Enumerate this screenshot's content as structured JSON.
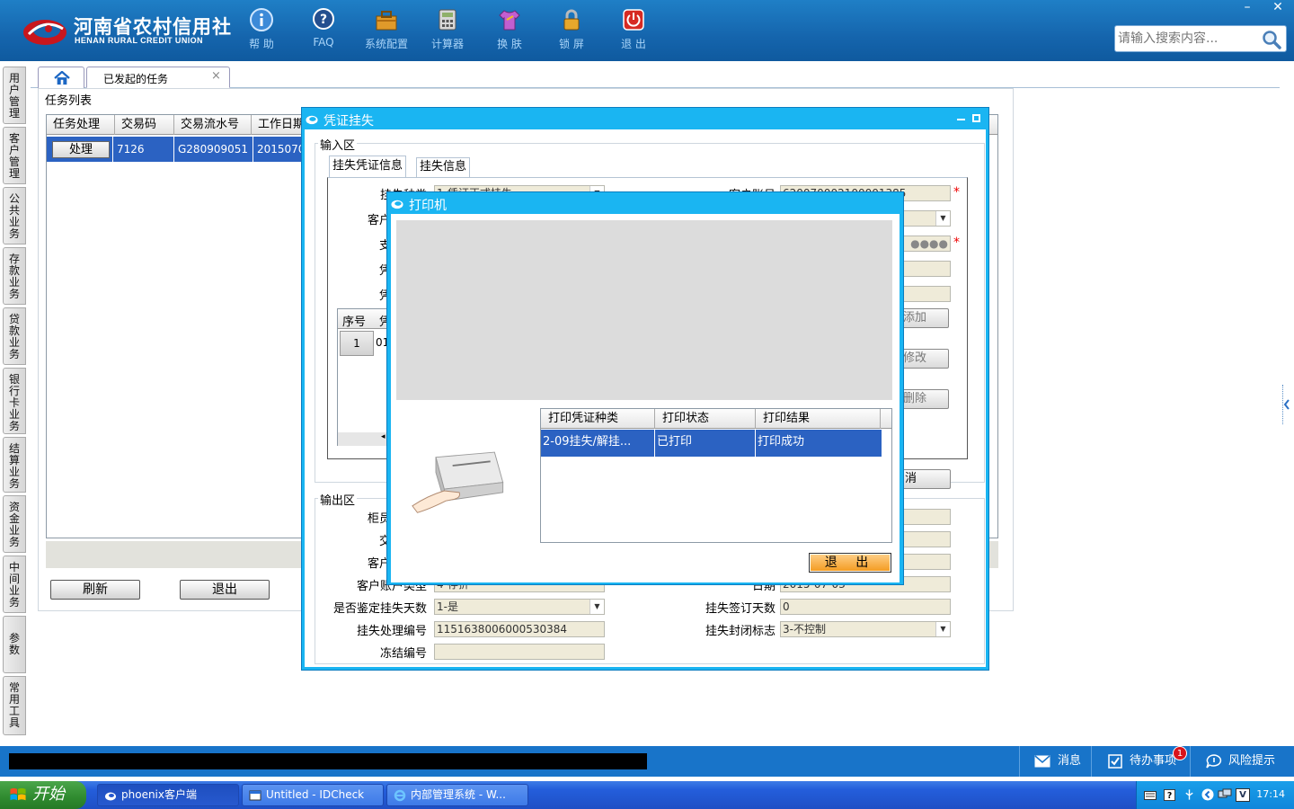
{
  "header": {
    "logo_cn": "河南省农村信用社",
    "logo_en": "HENAN RURAL CREDIT UNION",
    "toolbar": [
      {
        "label": "帮 助",
        "icon": "info-icon"
      },
      {
        "label": "FAQ",
        "icon": "help-icon"
      },
      {
        "label": "系统配置",
        "icon": "toolbox-icon"
      },
      {
        "label": "计算器",
        "icon": "calculator-icon"
      },
      {
        "label": "换 肤",
        "icon": "shirt-icon"
      },
      {
        "label": "锁 屏",
        "icon": "lock-icon"
      },
      {
        "label": "退 出",
        "icon": "power-icon"
      }
    ],
    "search_placeholder": "请输入搜索内容...",
    "window_controls": {
      "minimize": "–",
      "close": "✕"
    }
  },
  "left_nav": [
    "用户管理",
    "客户管理",
    "公共业务",
    "存款业务",
    "贷款业务",
    "银行卡业务",
    "结算业务",
    "资金业务",
    "中间业务",
    "参数",
    "常用工具"
  ],
  "tabs": {
    "active": "已发起的任务",
    "close": "×"
  },
  "task_panel": {
    "legend": "任务列表",
    "columns": [
      "任务处理",
      "交易码",
      "交易流水号",
      "工作日期"
    ],
    "row": {
      "action": "处理",
      "code": "7126",
      "serial": "G280909051",
      "date": "2015070"
    },
    "buttons": {
      "refresh": "刷新",
      "exit": "退出"
    }
  },
  "voucher_dialog": {
    "title": "凭证挂失",
    "input_legend": "输入区",
    "subtabs": [
      "挂失凭证信息",
      "挂失信息"
    ],
    "input_labels": [
      "挂失种类",
      "客户",
      "支",
      "凭",
      "凭"
    ],
    "loss_type_value": "1-凭证正式挂失",
    "account_label": "客户账号",
    "account_value": "620070002100001385",
    "password_mask": "●●●●",
    "voucher_grid": {
      "columns": [
        "序号",
        "凭"
      ],
      "row": {
        "no": "1",
        "val": "01"
      }
    },
    "side_buttons": [
      "添加",
      "修改",
      "删除"
    ],
    "cancel_button": "消",
    "output_legend": "输出区",
    "output_labels": [
      "柜员",
      "交",
      "客户",
      "客户账户类型"
    ],
    "account_type_value": "4-存折",
    "date_label": "日期",
    "date_value": "2015-07-03",
    "appraisal_label": "是否鉴定挂失天数",
    "appraisal_value": "1-是",
    "sign_days_label": "挂失签订天数",
    "sign_days_value": "0",
    "process_no_label": "挂失处理编号",
    "process_no_value": "1151638006000530384",
    "seal_flag_label": "挂失封闭标志",
    "seal_flag_value": "3-不控制",
    "freeze_no_label": "冻结编号",
    "freeze_no_value": ""
  },
  "printer_dialog": {
    "title": "打印机",
    "columns": [
      "打印凭证种类",
      "打印状态",
      "打印结果"
    ],
    "row": {
      "kind": "2-09挂失/解挂...",
      "status": "已打印",
      "result": "打印成功"
    },
    "exit_button": "退 出"
  },
  "status_bar": {
    "messages": "消息",
    "todo": "待办事项",
    "todo_count": "1",
    "risk": "风险提示"
  },
  "taskbar": {
    "start": "开始",
    "tasks": [
      "phoenix客户端",
      "Untitled - IDCheck",
      "内部管理系统 - W..."
    ],
    "clock": "17:14"
  }
}
